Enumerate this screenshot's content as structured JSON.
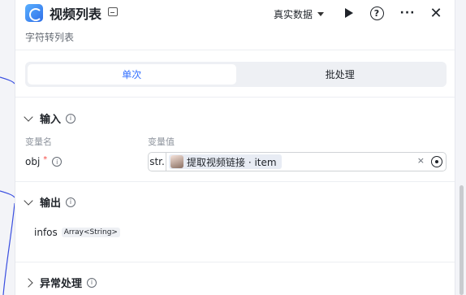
{
  "header": {
    "title": "视频列表",
    "subtitle": "字符转列表",
    "mode_select": "真实数据",
    "more_label": "···",
    "close_label": "✕",
    "help_label": "?"
  },
  "tabs": [
    {
      "label": "单次",
      "active": true
    },
    {
      "label": "批处理",
      "active": false
    }
  ],
  "input_section": {
    "title": "输入",
    "col_name": "变量名",
    "col_value": "变量值",
    "params": [
      {
        "name": "obj",
        "required_mark": "*",
        "type": "str.",
        "reference": "提取视频链接 · item",
        "clear_label": "×"
      }
    ]
  },
  "output_section": {
    "title": "输出",
    "fields": [
      {
        "name": "infos",
        "type": "Array<String>"
      }
    ]
  },
  "error_section": {
    "title": "异常处理"
  },
  "colors": {
    "accent": "#3370ff",
    "required": "#f54a45",
    "curve": "#3a4fe0"
  }
}
